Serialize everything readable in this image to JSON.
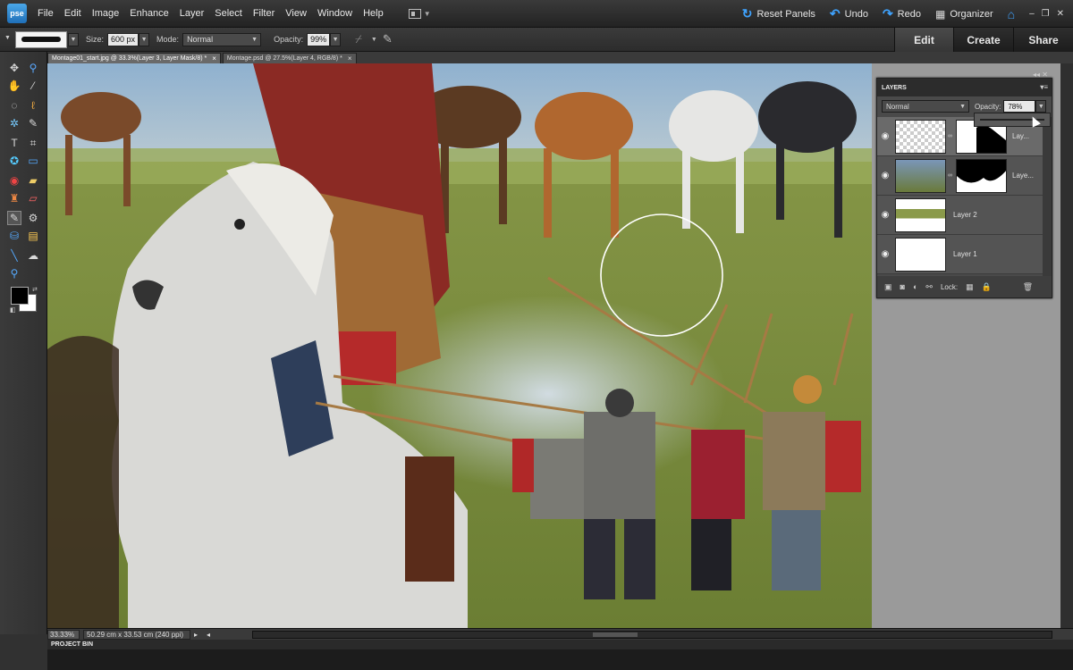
{
  "app": {
    "logo": "pse"
  },
  "menu": {
    "items": [
      "File",
      "Edit",
      "Image",
      "Enhance",
      "Layer",
      "Select",
      "Filter",
      "View",
      "Window",
      "Help"
    ],
    "reset_panels": "Reset Panels",
    "undo": "Undo",
    "redo": "Redo",
    "organizer": "Organizer"
  },
  "options": {
    "size_label": "Size:",
    "size_value": "600 px",
    "mode_label": "Mode:",
    "mode_value": "Normal",
    "opacity_label": "Opacity:",
    "opacity_value": "99%"
  },
  "mode_tabs": [
    "Edit",
    "Create",
    "Share"
  ],
  "doc_tabs": [
    {
      "label": "Montage01_start.jpg @ 33.3%(Layer 3, Layer Mask/8) *",
      "close": "×"
    },
    {
      "label": "Montage.psd @ 27.5%(Layer 4, RGB/8) *",
      "close": "×"
    }
  ],
  "layers_panel": {
    "title": "LAYERS",
    "blend_mode": "Normal",
    "opacity_label": "Opacity:",
    "opacity_value": "78%",
    "opacity_fraction": 0.78,
    "layers": [
      {
        "name": "Lay...",
        "selected": true
      },
      {
        "name": "Laye...",
        "selected": false
      },
      {
        "name": "Layer 2",
        "selected": false
      },
      {
        "name": "Layer 1",
        "selected": false
      }
    ],
    "lock_label": "Lock:"
  },
  "status": {
    "zoom": "33.33%",
    "doc_info": "50.29 cm x 33.53 cm (240 ppi)"
  },
  "project_bin": "PROJECT BIN",
  "colors": {
    "accent": "#3fa3ff",
    "foreground": "#000000",
    "background": "#ffffff"
  }
}
